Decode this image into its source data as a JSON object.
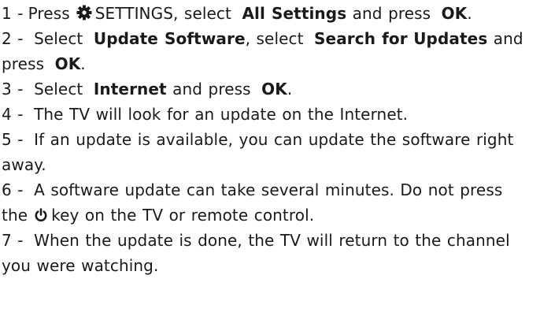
{
  "steps": [
    {
      "num": "1 -",
      "p1": "Press",
      "p2": "SETTINGS, select",
      "p3": "All Settings",
      "p4": "and",
      "p5": "press",
      "p6": "OK",
      "p7": "."
    },
    {
      "num": "2 -",
      "p1": "Select",
      "p2": "Update Software",
      "p3": ", select",
      "p4": "Search for",
      "p5": "Updates",
      "p6": "and press",
      "p7": "OK",
      "p8": "."
    },
    {
      "num": "3 -",
      "p1": "Select",
      "p2": "Internet",
      "p3": "and press",
      "p4": "OK",
      "p5": "."
    },
    {
      "num": "4 -",
      "text": "The TV will look for an update on the Internet."
    },
    {
      "num": "5 -",
      "text": "If an update is available, you can update the software right away."
    },
    {
      "num": "6 -",
      "p1": "A software update can take several minutes. Do not press the",
      "p2": "key on the TV or remote control."
    },
    {
      "num": "7 -",
      "text": "When the update is done, the TV will return to the channel you were watching."
    }
  ],
  "icons": {
    "settings": "gear-icon",
    "power": "power-icon"
  },
  "colors": {
    "text": "#1a1a1a",
    "background": "#ffffff"
  }
}
